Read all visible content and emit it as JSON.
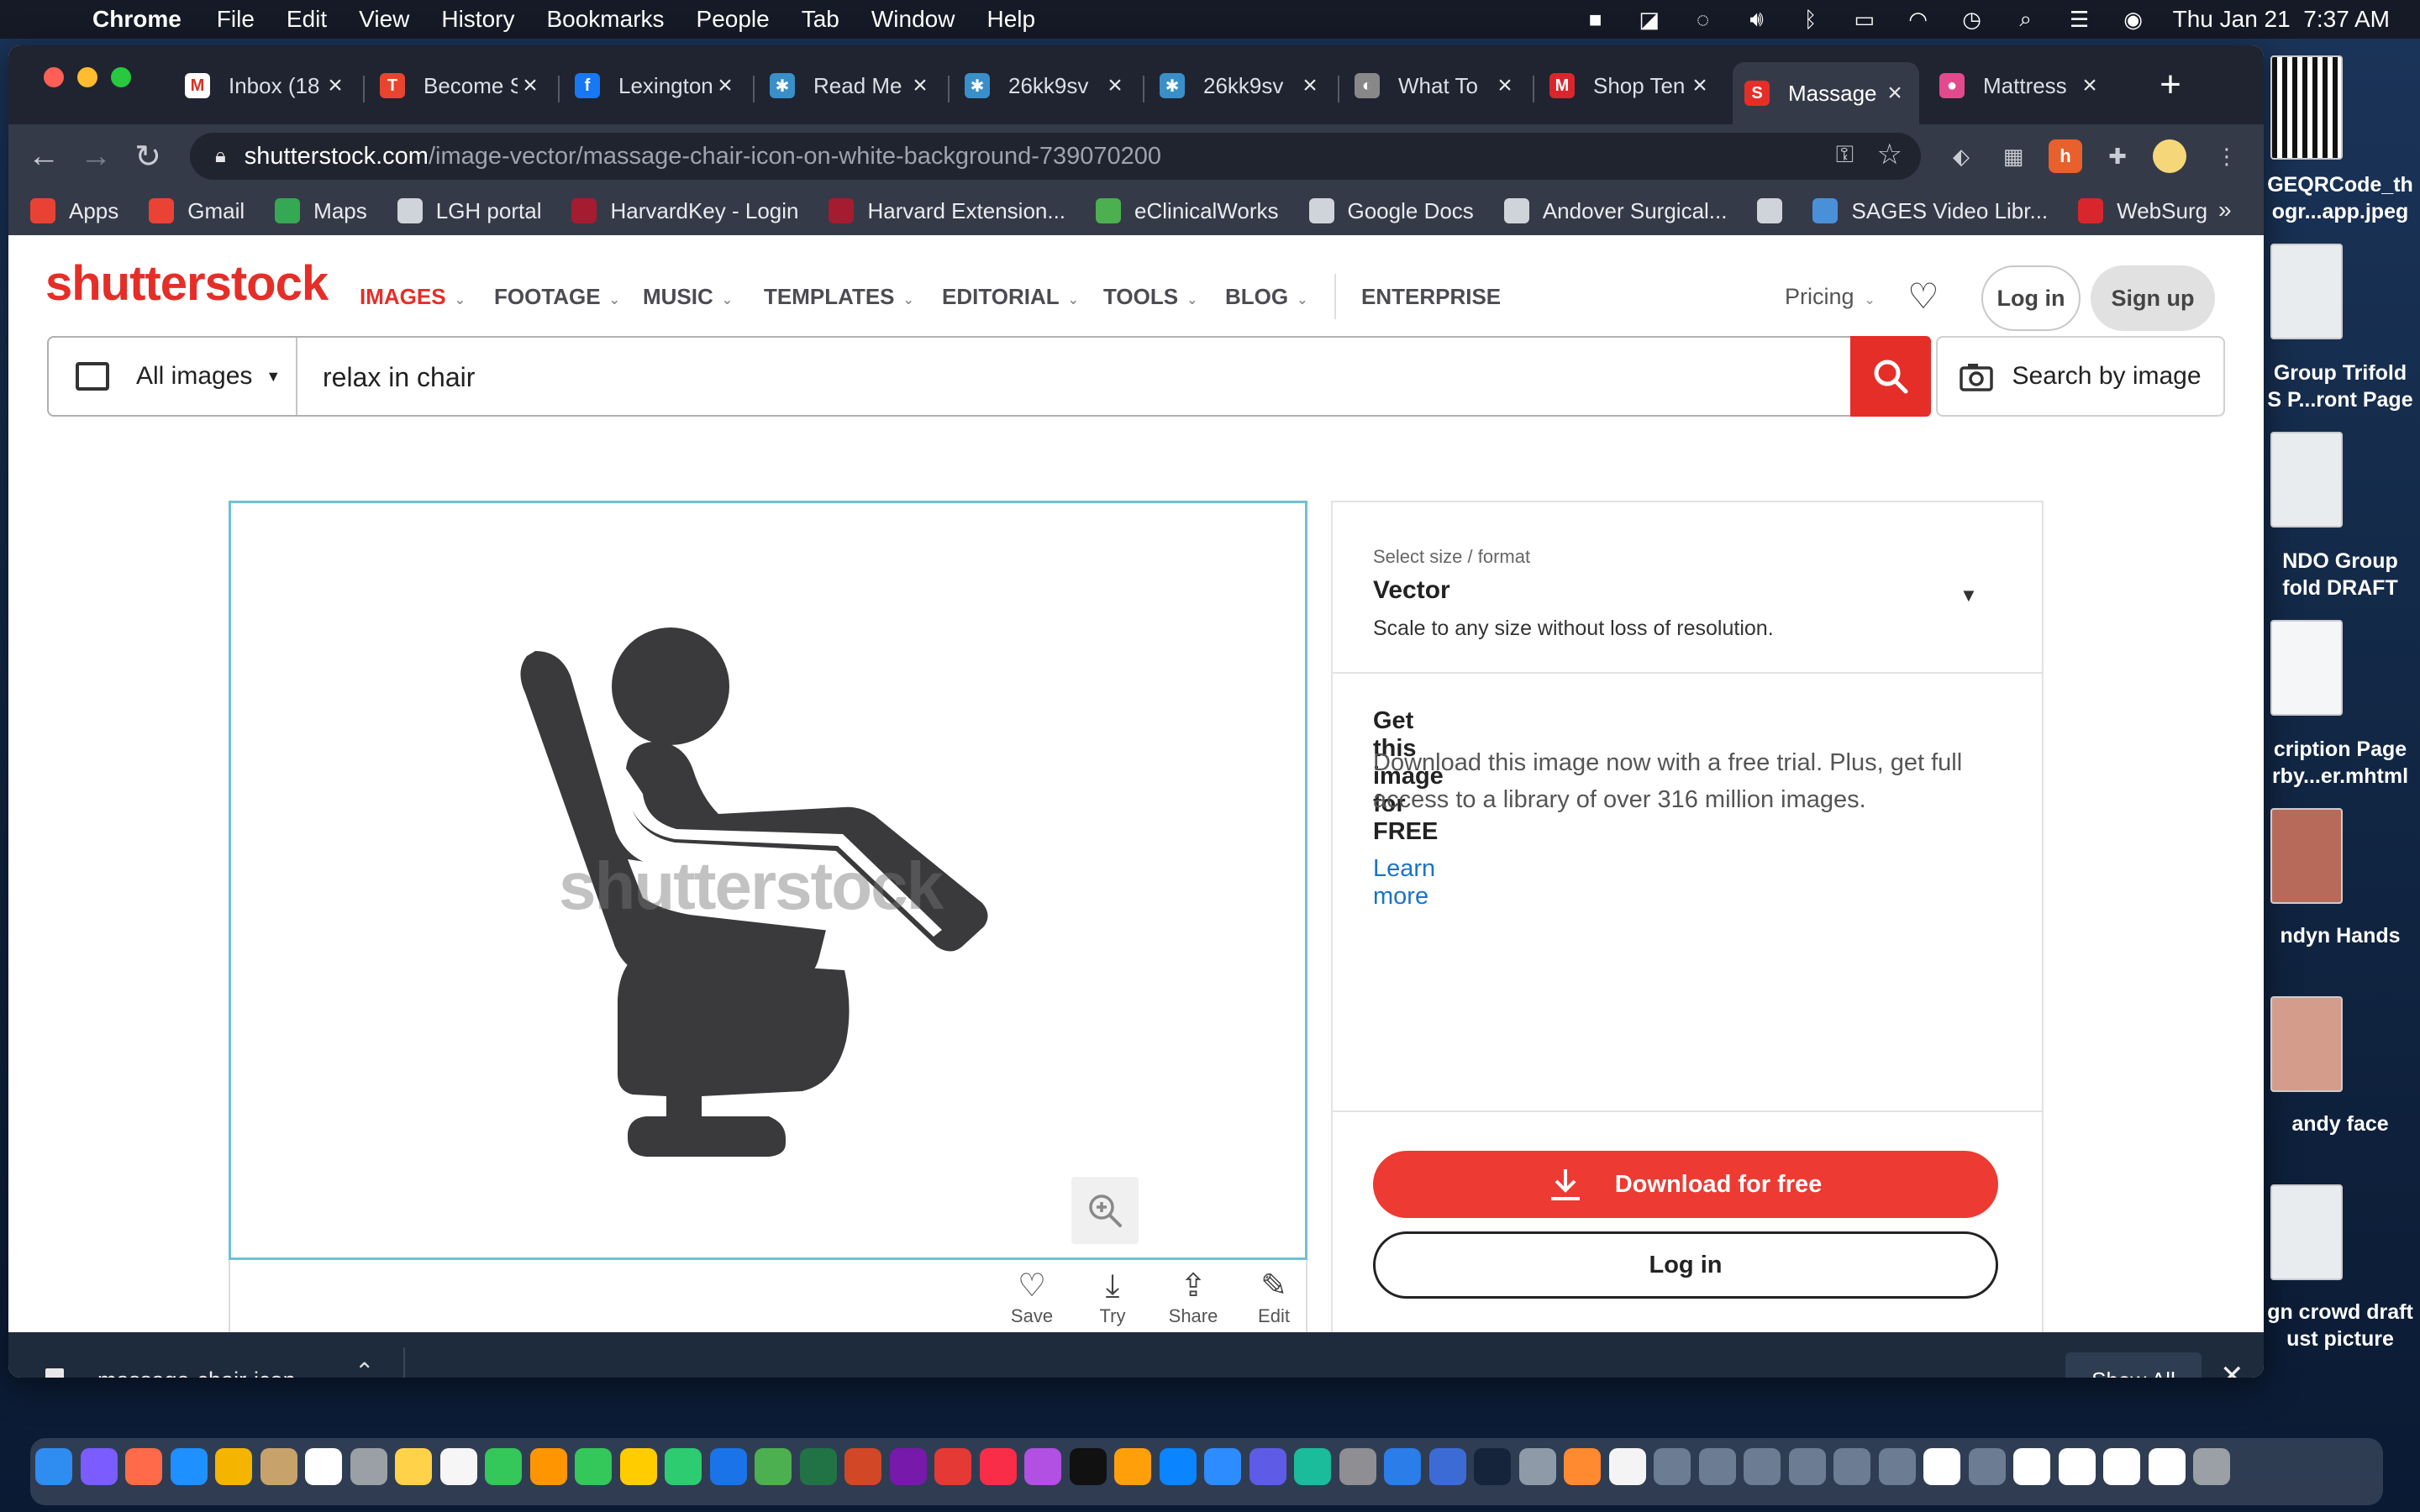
{
  "menubar": {
    "app": "Chrome",
    "items": [
      "File",
      "Edit",
      "View",
      "History",
      "Bookmarks",
      "People",
      "Tab",
      "Window",
      "Help"
    ],
    "clock": "Thu Jan 21  7:37 AM"
  },
  "tabs": [
    {
      "label": "Inbox (18",
      "color": "#ffffff",
      "glyph": "M"
    },
    {
      "label": "Become S",
      "color": "#e8442e",
      "glyph": "T"
    },
    {
      "label": "Lexington",
      "color": "#1877f2",
      "glyph": "f"
    },
    {
      "label": "Read Me",
      "color": "#3a8fc8",
      "glyph": "✱"
    },
    {
      "label": "26kk9sv",
      "color": "#3a8fc8",
      "glyph": "✱"
    },
    {
      "label": "26kk9sv",
      "color": "#3a8fc8",
      "glyph": "✱"
    },
    {
      "label": "What To",
      "color": "#888888",
      "glyph": "◐"
    },
    {
      "label": "Shop Ten",
      "color": "#d9262c",
      "glyph": "M"
    },
    {
      "label": "Massage",
      "color": "#e52e28",
      "glyph": "S"
    },
    {
      "label": "Mattress",
      "color": "#e24a8d",
      "glyph": "●"
    }
  ],
  "address": {
    "host": "shutterstock.com",
    "path": "/image-vector/massage-chair-icon-on-white-background-739070200"
  },
  "bookmarks": [
    {
      "label": "Apps",
      "icon": "apps-grid-icon",
      "color": "#e94235"
    },
    {
      "label": "Gmail",
      "icon": "gmail-icon",
      "color": "#ea4335"
    },
    {
      "label": "Maps",
      "icon": "maps-pin-icon",
      "color": "#34a853"
    },
    {
      "label": "LGH portal",
      "icon": "lock-icon",
      "color": "#cfd3da"
    },
    {
      "label": "HarvardKey - Login",
      "icon": "harvard-shield-icon",
      "color": "#a51c30"
    },
    {
      "label": "Harvard Extension...",
      "icon": "harvard-shield-icon",
      "color": "#a51c30"
    },
    {
      "label": "eClinicalWorks",
      "icon": "ecw-icon",
      "color": "#4caf50"
    },
    {
      "label": "Google Docs",
      "icon": "globe-icon",
      "color": "#cfd3da"
    },
    {
      "label": "Andover Surgical...",
      "icon": "globe-icon",
      "color": "#cfd3da"
    },
    {
      "label": "",
      "icon": "globe-icon",
      "color": "#cfd3da"
    },
    {
      "label": "SAGES Video Libr...",
      "icon": "sages-icon",
      "color": "#4a90d9"
    },
    {
      "label": "WebSurg",
      "icon": "websurg-icon",
      "color": "#d9262c"
    }
  ],
  "site": {
    "logo": "shutterstock",
    "nav": [
      "IMAGES",
      "FOOTAGE",
      "MUSIC",
      "TEMPLATES",
      "EDITORIAL",
      "TOOLS",
      "BLOG"
    ],
    "enterprise": "ENTERPRISE",
    "pricing": "Pricing",
    "login": "Log in",
    "signup": "Sign up"
  },
  "search": {
    "filter": "All images",
    "query": "relax in chair",
    "by_image": "Search by image"
  },
  "preview": {
    "watermark": "shutterstock"
  },
  "actions": [
    "Save",
    "Try",
    "Share",
    "Edit"
  ],
  "panel": {
    "size_label": "Select size / format",
    "size_value": "Vector",
    "size_desc": "Scale to any size without loss of resolution.",
    "free_title": "Get this image for FREE",
    "free_desc": "Download this image now with a free trial. Plus, get full access to a library of over 316 million images.",
    "learn_more": "Learn more",
    "download": "Download for free",
    "login": "Log in"
  },
  "downloads": {
    "file": "massage-chair-icon-...",
    "show_all": "Show All"
  },
  "desktop": [
    "GEQRCode_th\nogr...app.jpeg",
    "Group Trifold\nS P...ront Page",
    "NDO Group\nfold DRAFT",
    "cription Page\nrby...er.mhtml",
    "ndyn Hands",
    "andy face",
    "gn crowd draft\nust picture"
  ]
}
